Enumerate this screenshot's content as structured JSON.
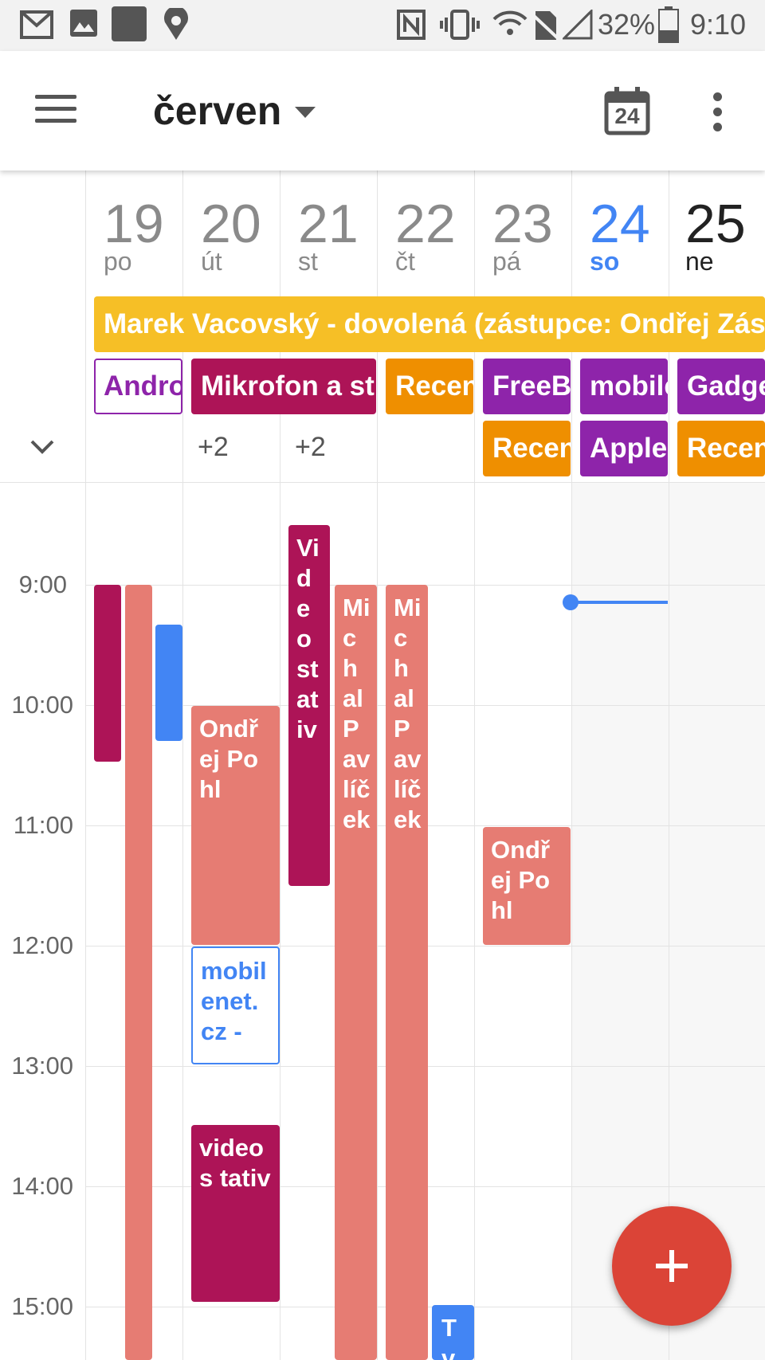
{
  "status_bar": {
    "battery": "32%",
    "time": "9:10",
    "icons": [
      "gmail-icon",
      "image-icon",
      "app-icon",
      "maps-icon",
      "nfc-icon",
      "vibrate-icon",
      "wifi-icon",
      "no-sim-icon",
      "signal-icon",
      "battery-icon"
    ]
  },
  "appbar": {
    "month": "červen",
    "today_day": "24",
    "icons": [
      "menu-icon",
      "dropdown-caret-icon",
      "today-calendar-icon",
      "more-vert-icon"
    ]
  },
  "days": [
    {
      "num": "19",
      "name": "po",
      "state": "past"
    },
    {
      "num": "20",
      "name": "út",
      "state": "past"
    },
    {
      "num": "21",
      "name": "st",
      "state": "past"
    },
    {
      "num": "22",
      "name": "čt",
      "state": "past"
    },
    {
      "num": "23",
      "name": "pá",
      "state": "past"
    },
    {
      "num": "24",
      "name": "so",
      "state": "today"
    },
    {
      "num": "25",
      "name": "ne",
      "state": "future"
    }
  ],
  "all_day": {
    "banner": "Marek Vacovský - dovolená (zástupce: Ondřej Zás",
    "chips": [
      "Andro",
      "Mikrofon a st",
      "Recen",
      "FreeBo",
      "mobile",
      "Gadge",
      "Recen",
      "Apple",
      "Recen"
    ],
    "more": [
      "+2",
      "+2"
    ]
  },
  "times": [
    "9:00",
    "10:00",
    "11:00",
    "12:00",
    "13:00",
    "14:00",
    "15:00"
  ],
  "events": [
    {
      "text": ""
    },
    {
      "text": ""
    },
    {
      "text": ""
    },
    {
      "text": "Ondřej Pohl"
    },
    {
      "text": "mobilenet.cz -"
    },
    {
      "text": "videos tativ"
    },
    {
      "text": "Videostativ"
    },
    {
      "text": "Michal Pavlíček"
    },
    {
      "text": "Michal Pavlíček"
    },
    {
      "text": "Ondřej Pohl"
    },
    {
      "text": "Tvoří"
    }
  ],
  "colors": {
    "banner": "#f6bf26",
    "purple": "#8e24aa",
    "magenta": "#ad1457",
    "orange": "#ef8f00",
    "salmon": "#e67c73",
    "blue": "#4285f4",
    "fab": "#db4437"
  },
  "fab_icon": "plus-icon"
}
